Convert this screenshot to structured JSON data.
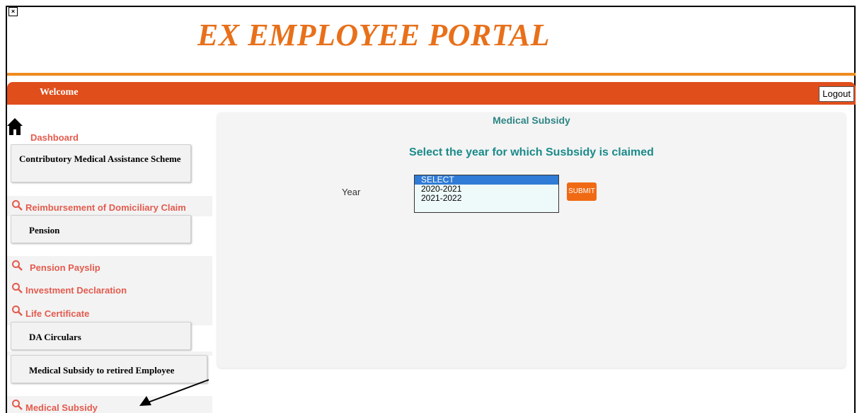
{
  "window": {
    "close_glyph": "×"
  },
  "header": {
    "title": "EX EMPLOYEE PORTAL"
  },
  "topbar": {
    "welcome": "Welcome",
    "logout": "Logout"
  },
  "sidebar": {
    "dashboard": "Dashboard",
    "sections": {
      "cmas": "Contributory Medical Assistance Scheme",
      "reimbursement": "Reimbursement of Domiciliary Claim",
      "pension": "Pension",
      "pension_payslip": "Pension Payslip",
      "investment": "Investment Declaration",
      "life_cert": "Life Certificate",
      "da": "DA Circulars",
      "medical_retired": "Medical Subsidy to retired Employee",
      "medical_subsidy": "Medical Subsidy"
    }
  },
  "main": {
    "title": "Medical Subsidy",
    "heading": "Select the year for which Susbsidy is claimed",
    "year_label": "Year",
    "year_options": [
      "SELECT",
      "2020-2021",
      "2021-2022"
    ],
    "selected_option": "SELECT",
    "submit": "SUBMIT"
  },
  "colors": {
    "accent": "#e04e1b",
    "title": "#e8701a",
    "link": "#e35b4e",
    "teal": "#1b8a8a"
  }
}
